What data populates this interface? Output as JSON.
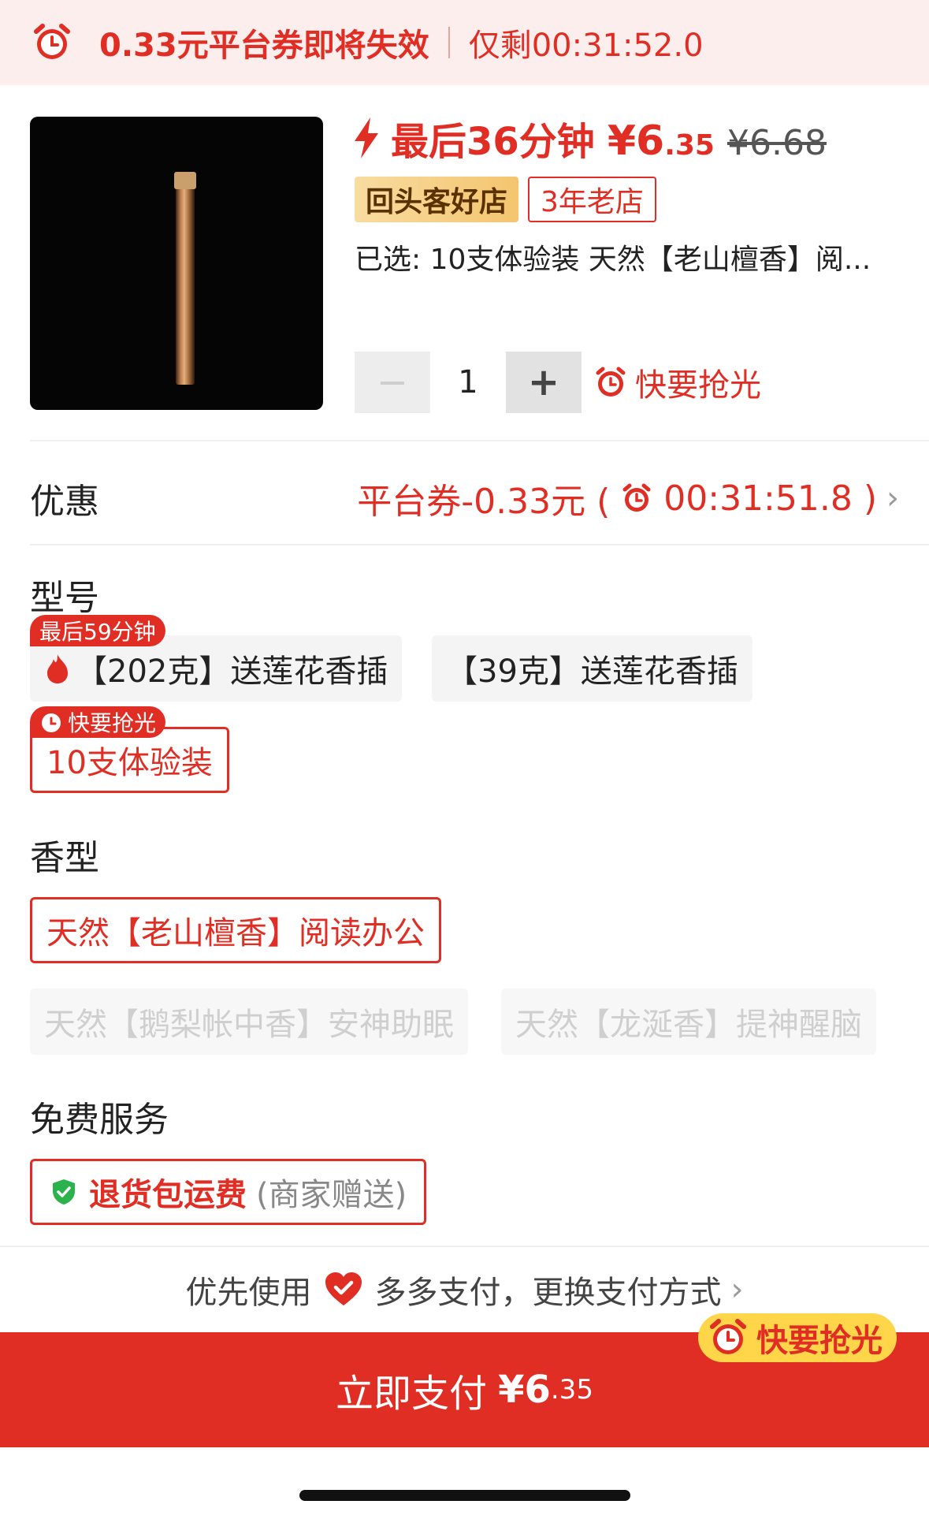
{
  "banner": {
    "message": "0.33元平台券即将失效",
    "remaining": "仅剩00:31:52.0"
  },
  "product": {
    "countdown_label": "最后36分钟",
    "currency": "¥",
    "price_int": "6",
    "price_dec": ".35",
    "original_price": "¥6.68",
    "tag_returning": "回头客好店",
    "tag_store_age": "3年老店",
    "selected_text": "已选: 10支体验装 天然【老山檀香】阅...",
    "quantity": "1",
    "hurry_text": "快要抢光"
  },
  "discount": {
    "label": "优惠",
    "value": "平台券-0.33元 (",
    "timer": "00:31:51.8 )"
  },
  "model": {
    "title": "型号",
    "options": [
      {
        "label": "【202克】送莲花香插",
        "badge": "最后59分钟"
      },
      {
        "label": "【39克】送莲花香插"
      },
      {
        "label": "10支体验装",
        "badge": "快要抢光"
      }
    ]
  },
  "scent": {
    "title": "香型",
    "options": [
      {
        "label": "天然【老山檀香】阅读办公"
      },
      {
        "label": "天然【鹅梨帐中香】安神助眠"
      },
      {
        "label": "天然【龙涎香】提神醒脑"
      }
    ]
  },
  "service": {
    "title": "免费服务",
    "main": "退货包运费",
    "sub": "(商家赠送)"
  },
  "payment": {
    "prefix": "优先使用",
    "method": "多多支付，更换支付方式",
    "button_label": "立即支付",
    "button_currency": "¥",
    "button_price_int": "6",
    "button_price_dec": ".35",
    "hurry_text": "快要抢光"
  },
  "colors": {
    "accent": "#e02e24",
    "banner_bg": "#fdeeee",
    "gold": "#ffd64a"
  }
}
